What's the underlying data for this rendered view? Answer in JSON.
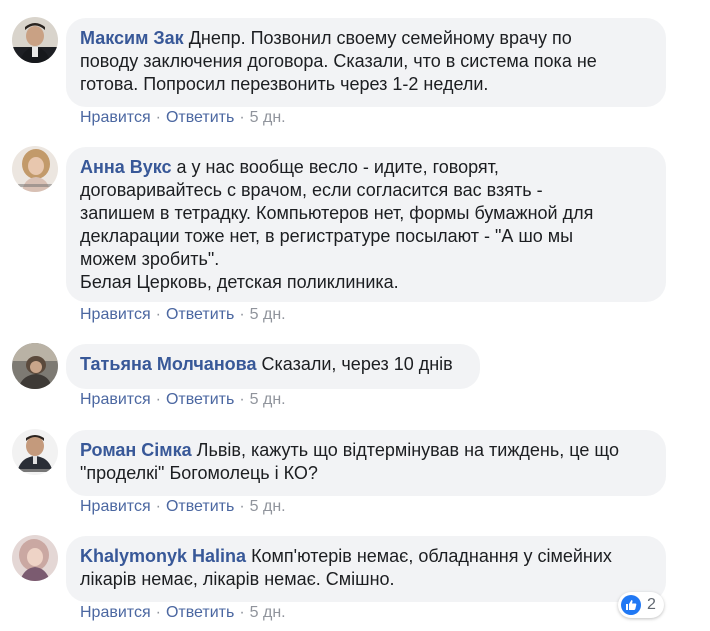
{
  "comments": [
    {
      "author": "Максим Зак",
      "lines": [
        " Днепр. Позвонил своему семейному врачу по",
        "поводу заключения договора. Сказали, что в система пока не",
        "готова. Попросил перезвонить через 1-2 недели."
      ],
      "like": "Нравится",
      "reply": "Ответить",
      "time": "5 дн."
    },
    {
      "author": "Анна Вукс",
      "lines": [
        " а у нас вообще весло - идите, говорят,",
        "договаривайтесь с врачом, если согласится вас взять -",
        "запишем в тетрадку. Компьютеров нет, формы бумажной для",
        "декларации тоже нет, в регистратуре посылают - \"А шо мы",
        "можем зробить\".",
        "Белая Церковь, детская поликлиника."
      ],
      "like": "Нравится",
      "reply": "Ответить",
      "time": "5 дн."
    },
    {
      "author": "Татьяна Молчанова",
      "lines": [
        " Сказали, через 10 днів"
      ],
      "like": "Нравится",
      "reply": "Ответить",
      "time": "5 дн."
    },
    {
      "author": "Роман Сімка",
      "lines": [
        " Львів, кажуть що відтермінував на тиждень, це що",
        "\"проделкі\" Богомолець і КО?"
      ],
      "like": "Нравится",
      "reply": "Ответить",
      "time": "5 дн."
    },
    {
      "author": "Khalymonyk Halina",
      "lines": [
        " Комп'ютерів немає, обладнання у сімейних",
        "лікарів немає, лікарів немає. Смішно."
      ],
      "like": "Нравится",
      "reply": "Ответить",
      "time": "5 дн.",
      "reaction_icon": "like-icon",
      "reaction_count": "2"
    }
  ],
  "colors": {
    "author": "#385898",
    "action_link": "#4b67a1",
    "bubble": "#f2f3f5",
    "like_badge": "#2078f4"
  }
}
